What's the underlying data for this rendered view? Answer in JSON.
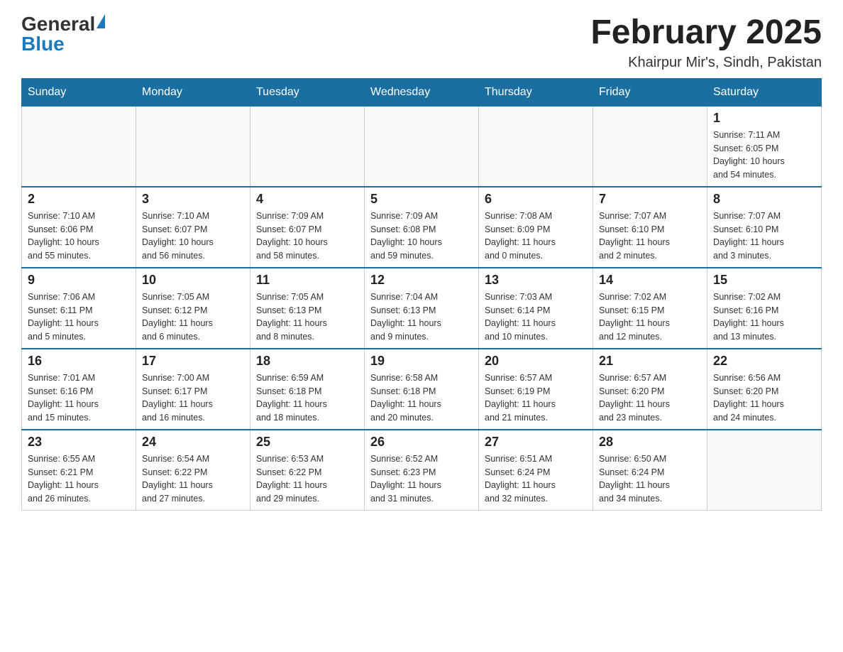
{
  "header": {
    "logo_general": "General",
    "logo_blue": "Blue",
    "month_title": "February 2025",
    "location": "Khairpur Mir's, Sindh, Pakistan"
  },
  "weekdays": [
    "Sunday",
    "Monday",
    "Tuesday",
    "Wednesday",
    "Thursday",
    "Friday",
    "Saturday"
  ],
  "weeks": [
    [
      {
        "day": "",
        "info": ""
      },
      {
        "day": "",
        "info": ""
      },
      {
        "day": "",
        "info": ""
      },
      {
        "day": "",
        "info": ""
      },
      {
        "day": "",
        "info": ""
      },
      {
        "day": "",
        "info": ""
      },
      {
        "day": "1",
        "info": "Sunrise: 7:11 AM\nSunset: 6:05 PM\nDaylight: 10 hours\nand 54 minutes."
      }
    ],
    [
      {
        "day": "2",
        "info": "Sunrise: 7:10 AM\nSunset: 6:06 PM\nDaylight: 10 hours\nand 55 minutes."
      },
      {
        "day": "3",
        "info": "Sunrise: 7:10 AM\nSunset: 6:07 PM\nDaylight: 10 hours\nand 56 minutes."
      },
      {
        "day": "4",
        "info": "Sunrise: 7:09 AM\nSunset: 6:07 PM\nDaylight: 10 hours\nand 58 minutes."
      },
      {
        "day": "5",
        "info": "Sunrise: 7:09 AM\nSunset: 6:08 PM\nDaylight: 10 hours\nand 59 minutes."
      },
      {
        "day": "6",
        "info": "Sunrise: 7:08 AM\nSunset: 6:09 PM\nDaylight: 11 hours\nand 0 minutes."
      },
      {
        "day": "7",
        "info": "Sunrise: 7:07 AM\nSunset: 6:10 PM\nDaylight: 11 hours\nand 2 minutes."
      },
      {
        "day": "8",
        "info": "Sunrise: 7:07 AM\nSunset: 6:10 PM\nDaylight: 11 hours\nand 3 minutes."
      }
    ],
    [
      {
        "day": "9",
        "info": "Sunrise: 7:06 AM\nSunset: 6:11 PM\nDaylight: 11 hours\nand 5 minutes."
      },
      {
        "day": "10",
        "info": "Sunrise: 7:05 AM\nSunset: 6:12 PM\nDaylight: 11 hours\nand 6 minutes."
      },
      {
        "day": "11",
        "info": "Sunrise: 7:05 AM\nSunset: 6:13 PM\nDaylight: 11 hours\nand 8 minutes."
      },
      {
        "day": "12",
        "info": "Sunrise: 7:04 AM\nSunset: 6:13 PM\nDaylight: 11 hours\nand 9 minutes."
      },
      {
        "day": "13",
        "info": "Sunrise: 7:03 AM\nSunset: 6:14 PM\nDaylight: 11 hours\nand 10 minutes."
      },
      {
        "day": "14",
        "info": "Sunrise: 7:02 AM\nSunset: 6:15 PM\nDaylight: 11 hours\nand 12 minutes."
      },
      {
        "day": "15",
        "info": "Sunrise: 7:02 AM\nSunset: 6:16 PM\nDaylight: 11 hours\nand 13 minutes."
      }
    ],
    [
      {
        "day": "16",
        "info": "Sunrise: 7:01 AM\nSunset: 6:16 PM\nDaylight: 11 hours\nand 15 minutes."
      },
      {
        "day": "17",
        "info": "Sunrise: 7:00 AM\nSunset: 6:17 PM\nDaylight: 11 hours\nand 16 minutes."
      },
      {
        "day": "18",
        "info": "Sunrise: 6:59 AM\nSunset: 6:18 PM\nDaylight: 11 hours\nand 18 minutes."
      },
      {
        "day": "19",
        "info": "Sunrise: 6:58 AM\nSunset: 6:18 PM\nDaylight: 11 hours\nand 20 minutes."
      },
      {
        "day": "20",
        "info": "Sunrise: 6:57 AM\nSunset: 6:19 PM\nDaylight: 11 hours\nand 21 minutes."
      },
      {
        "day": "21",
        "info": "Sunrise: 6:57 AM\nSunset: 6:20 PM\nDaylight: 11 hours\nand 23 minutes."
      },
      {
        "day": "22",
        "info": "Sunrise: 6:56 AM\nSunset: 6:20 PM\nDaylight: 11 hours\nand 24 minutes."
      }
    ],
    [
      {
        "day": "23",
        "info": "Sunrise: 6:55 AM\nSunset: 6:21 PM\nDaylight: 11 hours\nand 26 minutes."
      },
      {
        "day": "24",
        "info": "Sunrise: 6:54 AM\nSunset: 6:22 PM\nDaylight: 11 hours\nand 27 minutes."
      },
      {
        "day": "25",
        "info": "Sunrise: 6:53 AM\nSunset: 6:22 PM\nDaylight: 11 hours\nand 29 minutes."
      },
      {
        "day": "26",
        "info": "Sunrise: 6:52 AM\nSunset: 6:23 PM\nDaylight: 11 hours\nand 31 minutes."
      },
      {
        "day": "27",
        "info": "Sunrise: 6:51 AM\nSunset: 6:24 PM\nDaylight: 11 hours\nand 32 minutes."
      },
      {
        "day": "28",
        "info": "Sunrise: 6:50 AM\nSunset: 6:24 PM\nDaylight: 11 hours\nand 34 minutes."
      },
      {
        "day": "",
        "info": ""
      }
    ]
  ]
}
